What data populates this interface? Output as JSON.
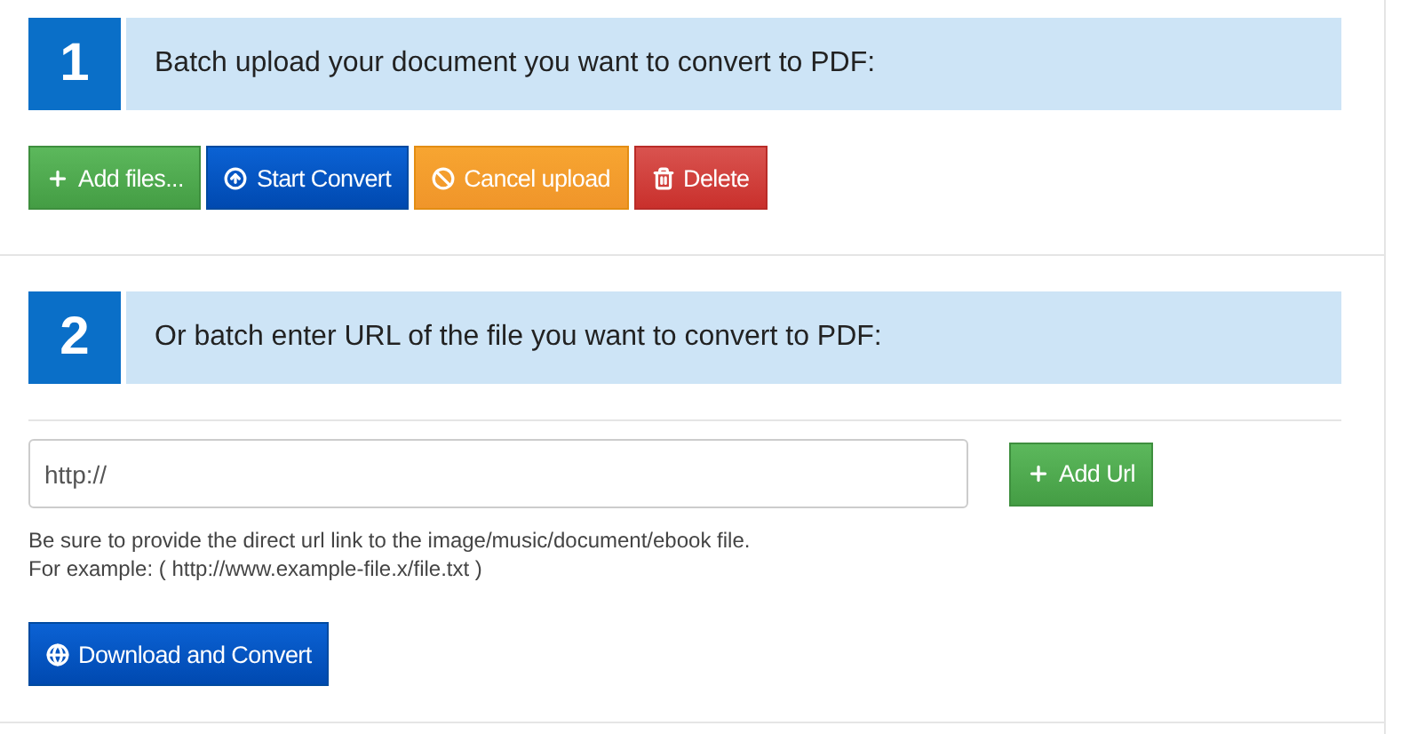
{
  "steps": [
    {
      "number": "1",
      "title": "Batch upload your document you want to convert to PDF:"
    },
    {
      "number": "2",
      "title": "Or batch enter URL of the file you want to convert to PDF:"
    }
  ],
  "upload_buttons": [
    {
      "label": "Add files...",
      "kind": "success"
    },
    {
      "label": "Start Convert",
      "kind": "primary"
    },
    {
      "label": "Cancel upload",
      "kind": "warning"
    },
    {
      "label": "Delete",
      "kind": "danger"
    }
  ],
  "url_field": {
    "value": "http://"
  },
  "add_url_button": {
    "label": "Add Url",
    "kind": "success"
  },
  "help_lines": [
    "Be sure to provide the direct url link to the image/music/document/ebook file.",
    "For example: ( http://www.example-file.x/file.txt )"
  ],
  "download_button": {
    "label": "Download and Convert",
    "kind": "primary"
  }
}
